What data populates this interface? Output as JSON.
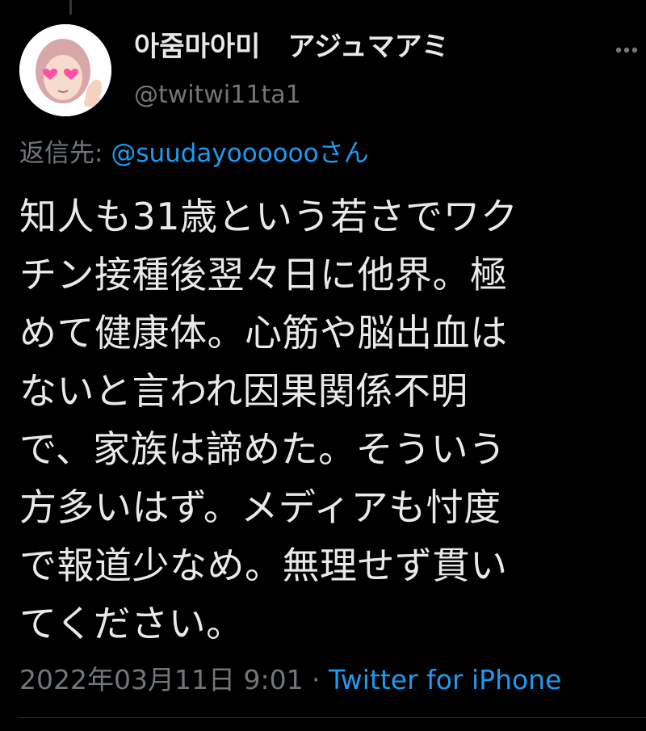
{
  "tweet": {
    "display_name": "아줌마아미　アジュマアミ",
    "handle": "@twitwi11ta1",
    "reply": {
      "prefix": "返信先: ",
      "mention": "@suudayoooooo",
      "suffix": "さん"
    },
    "text_lines": [
      "知人も31歳という若さでワク",
      "チン接種後翌々日に他界。極",
      "めて健康体。心筋や脳出血は",
      "ないと言われ因果関係不明",
      "で、家族は諦めた。そういう",
      "方多いはず。メディアも忖度",
      "で報道少なめ。無理せず貫い",
      "てください。"
    ],
    "timestamp": "2022年03月11日 9:01",
    "separator": " · ",
    "source": "Twitter for iPhone"
  },
  "icons": {
    "more": "more-dots-icon",
    "avatar": "profile-avatar"
  },
  "colors": {
    "background": "#000000",
    "text": "#e7e9ea",
    "muted": "#71767b",
    "link": "#1d9bf0"
  }
}
